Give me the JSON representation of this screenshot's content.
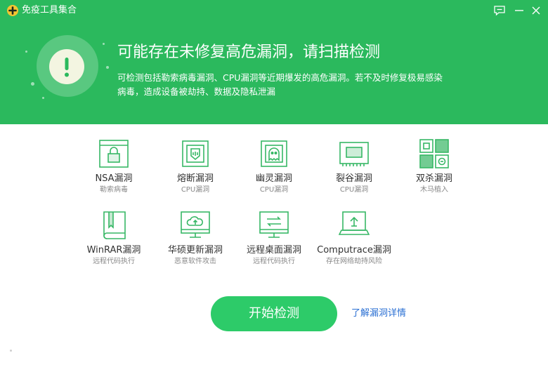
{
  "app": {
    "title": "免疫工具集合",
    "icons": {
      "logo": "app-logo-icon",
      "feedback": "feedback-icon",
      "minimize": "minimize-icon",
      "close": "close-icon"
    }
  },
  "banner": {
    "headline": "可能存在未修复高危漏洞，请扫描检测",
    "description": "可检测包括勒索病毒漏洞、CPU漏洞等近期爆发的高危漏洞。若不及时修复极易感染病毒，造成设备被劫持、数据及隐私泄漏",
    "icon": "exclamation-icon"
  },
  "tools": [
    {
      "name": "NSA漏洞",
      "sub": "勒索病毒",
      "icon": "browser-lock-icon"
    },
    {
      "name": "熔断漏洞",
      "sub": "CPU漏洞",
      "icon": "chip-icon"
    },
    {
      "name": "幽灵漏洞",
      "sub": "CPU漏洞",
      "icon": "ghost-chip-icon"
    },
    {
      "name": "裂谷漏洞",
      "sub": "CPU漏洞",
      "icon": "memory-board-icon"
    },
    {
      "name": "双杀漏洞",
      "sub": "木马植入",
      "icon": "grid-browser-icon"
    },
    {
      "name": "WinRAR漏洞",
      "sub": "远程代码执行",
      "icon": "archive-book-icon"
    },
    {
      "name": "华硕更新漏洞",
      "sub": "恶意软件攻击",
      "icon": "cloud-monitor-icon"
    },
    {
      "name": "远程桌面漏洞",
      "sub": "远程代码执行",
      "icon": "remote-desktop-icon"
    },
    {
      "name": "Computrace漏洞",
      "sub": "存在网络劫持风险",
      "icon": "laptop-upload-icon"
    }
  ],
  "actions": {
    "start_label": "开始检测",
    "detail_link": "了解漏洞详情"
  },
  "colors": {
    "brand_green": "#2bb95d",
    "button_green": "#2dcb69",
    "icon_green": "#37b765",
    "link_blue": "#2a6fd3"
  }
}
